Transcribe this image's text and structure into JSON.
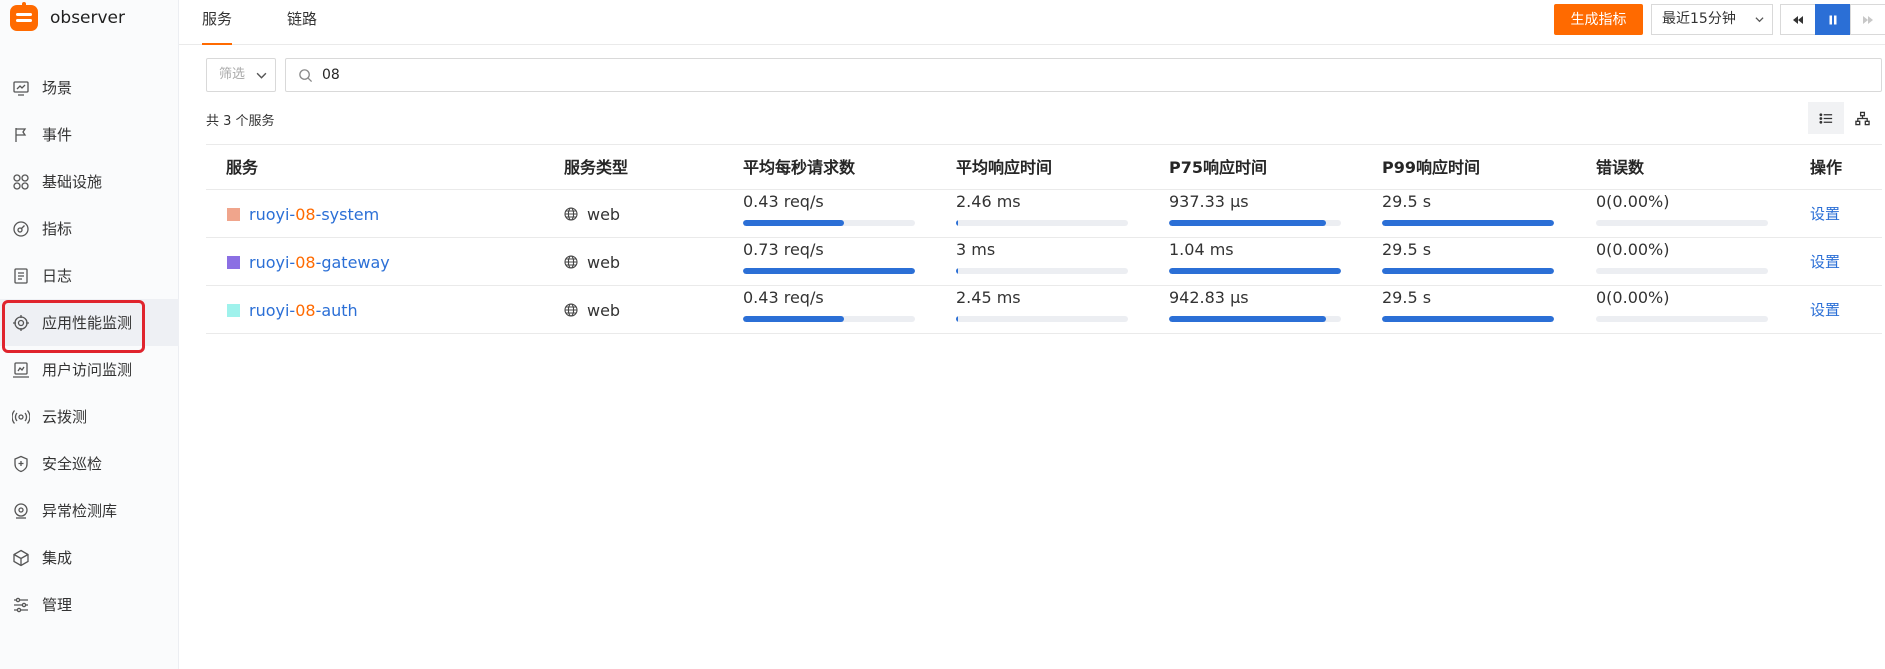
{
  "app": {
    "name": "observer"
  },
  "sidebar": {
    "items": [
      {
        "label": "场景",
        "icon": "dashboard-icon"
      },
      {
        "label": "事件",
        "icon": "flag-icon"
      },
      {
        "label": "基础设施",
        "icon": "grid-icon"
      },
      {
        "label": "指标",
        "icon": "metric-icon"
      },
      {
        "label": "日志",
        "icon": "log-icon"
      },
      {
        "label": "应用性能监测",
        "icon": "apm-icon",
        "active": true
      },
      {
        "label": "用户访问监测",
        "icon": "rum-icon"
      },
      {
        "label": "云拨测",
        "icon": "dial-test-icon"
      },
      {
        "label": "安全巡检",
        "icon": "shield-icon"
      },
      {
        "label": "异常检测库",
        "icon": "anomaly-icon"
      },
      {
        "label": "集成",
        "icon": "integration-icon"
      },
      {
        "label": "管理",
        "icon": "settings-icon"
      }
    ]
  },
  "tabs": [
    {
      "label": "服务",
      "active": true
    },
    {
      "label": "链路",
      "active": false
    }
  ],
  "toolbar": {
    "generate_label": "生成指标",
    "time_range": "最近15分钟"
  },
  "filter": {
    "select_placeholder": "筛选",
    "search_value": "08"
  },
  "summary": {
    "count_text": "共 3 个服务"
  },
  "table": {
    "headers": [
      "服务",
      "服务类型",
      "平均每秒请求数",
      "平均响应时间",
      "P75响应时间",
      "P99响应时间",
      "错误数",
      "操作"
    ],
    "rows": [
      {
        "name_prefix": "ruoyi-",
        "name_match": "08",
        "name_suffix": "-system",
        "color": "#f0a58c",
        "type": "web",
        "req": "0.43 req/s",
        "req_pct": 0.59,
        "avg": "2.46 ms",
        "avg_pct": 0.01,
        "p75": "937.33 µs",
        "p75_pct": 0.91,
        "p99": "29.5 s",
        "p99_pct": 1.0,
        "err": "0(0.00%)",
        "err_pct": 0,
        "action": "设置"
      },
      {
        "name_prefix": "ruoyi-",
        "name_match": "08",
        "name_suffix": "-gateway",
        "color": "#8b6fe3",
        "type": "web",
        "req": "0.73 req/s",
        "req_pct": 1.0,
        "avg": "3 ms",
        "avg_pct": 0.01,
        "p75": "1.04 ms",
        "p75_pct": 1.0,
        "p99": "29.5 s",
        "p99_pct": 1.0,
        "err": "0(0.00%)",
        "err_pct": 0,
        "action": "设置"
      },
      {
        "name_prefix": "ruoyi-",
        "name_match": "08",
        "name_suffix": "-auth",
        "color": "#9ff2ec",
        "type": "web",
        "req": "0.43 req/s",
        "req_pct": 0.59,
        "avg": "2.45 ms",
        "avg_pct": 0.01,
        "p75": "942.83 µs",
        "p75_pct": 0.91,
        "p99": "29.5 s",
        "p99_pct": 1.0,
        "err": "0(0.00%)",
        "err_pct": 0,
        "action": "设置"
      }
    ]
  }
}
